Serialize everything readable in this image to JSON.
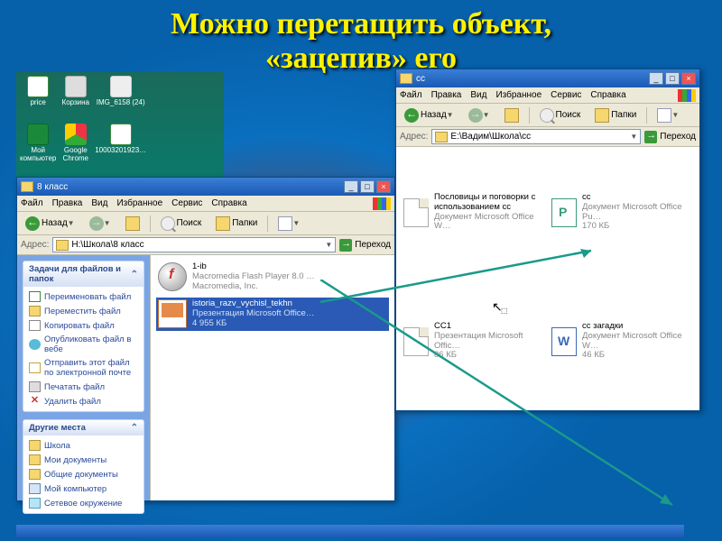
{
  "slide_title_l1": "Можно перетащить объект,",
  "slide_title_l2": "«зацепив» его",
  "desktop_icons": [
    "price",
    "Корзина",
    "IMG_6158 (24)",
    "",
    "",
    "Мой компьютер",
    "Google Chrome",
    "10003201923…",
    "",
    ""
  ],
  "menu": {
    "file": "Файл",
    "edit": "Правка",
    "view": "Вид",
    "fav": "Избранное",
    "tools": "Сервис",
    "help": "Справка"
  },
  "tb": {
    "back": "Назад",
    "search": "Поиск",
    "folders": "Папки"
  },
  "addr": {
    "label": "Адрес:",
    "go": "Переход"
  },
  "win1": {
    "title": "8 класс",
    "path": "H:\\Школа\\8 класс",
    "taskpane": {
      "group1_title": "Задачи для файлов и папок",
      "group2_title": "Другие места",
      "rename": "Переименовать файл",
      "move": "Переместить файл",
      "copy": "Копировать файл",
      "web": "Опубликовать файл в вебе",
      "mail": "Отправить этот файл по электронной почте",
      "print": "Печатать файл",
      "del": "Удалить файл",
      "place1": "Школа",
      "place2": "Мои документы",
      "place3": "Общие документы",
      "place4": "Мой компьютер",
      "place5": "Сетевое окружение"
    },
    "files": {
      "f1_name": "1-ib",
      "f1_meta1": "Macromedia Flash Player 8.0 …",
      "f1_meta2": "Macromedia, Inc.",
      "f2_name": "istoria_razv_vychisl_tekhn",
      "f2_meta1": "Презентация Microsoft Office…",
      "f2_meta2": "4 955 КБ"
    }
  },
  "win2": {
    "title": "сс",
    "path": "E:\\Вадим\\Школа\\сс",
    "files": {
      "a_name": "Пословицы и поговорки с использованием сс",
      "a_meta": "Документ Microsoft Office W…",
      "b_name": "сс",
      "b_meta1": "Документ Microsoft Office Pu…",
      "b_meta2": "170 КБ",
      "c_name": "СС1",
      "c_meta1": "Презентация Microsoft Offic…",
      "c_meta2": "86 КБ",
      "d_name": "сс загадки",
      "d_meta1": "Документ Microsoft Office W…",
      "d_meta2": "46 КБ"
    }
  }
}
